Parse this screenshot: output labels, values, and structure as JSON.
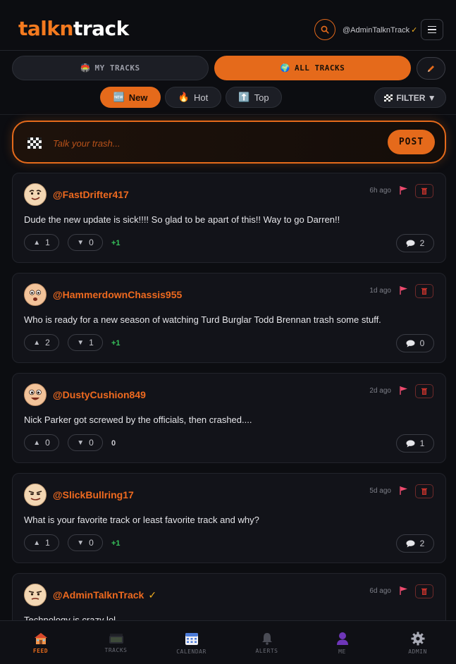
{
  "app": {
    "logo_part1": "talkn",
    "logo_part2": "track",
    "user_handle": "@AdminTalknTrack",
    "verified_mark": "✓"
  },
  "tracks_toggle": {
    "my_tracks_icon": "🏟️",
    "my_tracks_label": "MY TRACKS",
    "all_tracks_icon": "🌍",
    "all_tracks_label": "ALL TRACKS"
  },
  "sort": {
    "new": {
      "icon": "🆕",
      "label": "New"
    },
    "hot": {
      "icon": "🔥",
      "label": "Hot"
    },
    "top": {
      "icon": "⬆️",
      "label": "Top"
    },
    "filter_label": "FILTER ▼"
  },
  "composer": {
    "placeholder": "Talk your trash...",
    "post_label": "POST"
  },
  "posts": [
    {
      "user": "@FastDrifter417",
      "time": "6h ago",
      "text": "Dude the new update is sick!!!! So glad to be apart of this!! Way to go Darren!!",
      "up": "1",
      "down": "0",
      "score": "+1",
      "comments": "2"
    },
    {
      "user": "@HammerdownChassis955",
      "time": "1d ago",
      "text": "Who is ready for a new season of watching Turd Burglar Todd Brennan trash some stuff.",
      "up": "2",
      "down": "1",
      "score": "+1",
      "comments": "0"
    },
    {
      "user": "@DustyCushion849",
      "time": "2d ago",
      "text": "Nick Parker got screwed by the officials, then crashed....",
      "up": "0",
      "down": "0",
      "score": "0",
      "comments": "1"
    },
    {
      "user": "@SlickBullring17",
      "time": "5d ago",
      "text": "What is your favorite track or least favorite track and why?",
      "up": "1",
      "down": "0",
      "score": "+1",
      "comments": "2"
    },
    {
      "user": "@AdminTalknTrack",
      "verified": "✓",
      "time": "6d ago",
      "text": "Technology is crazy lol"
    }
  ],
  "nav": {
    "feed": "FEED",
    "tracks": "TRACKS",
    "calendar": "CALENDAR",
    "alerts": "ALERTS",
    "me": "ME",
    "admin": "ADMIN"
  },
  "colors": {
    "accent": "#e56a1b",
    "background": "#0c0d11",
    "card": "#121319",
    "positive": "#37c15a",
    "verified": "#f3b020"
  }
}
